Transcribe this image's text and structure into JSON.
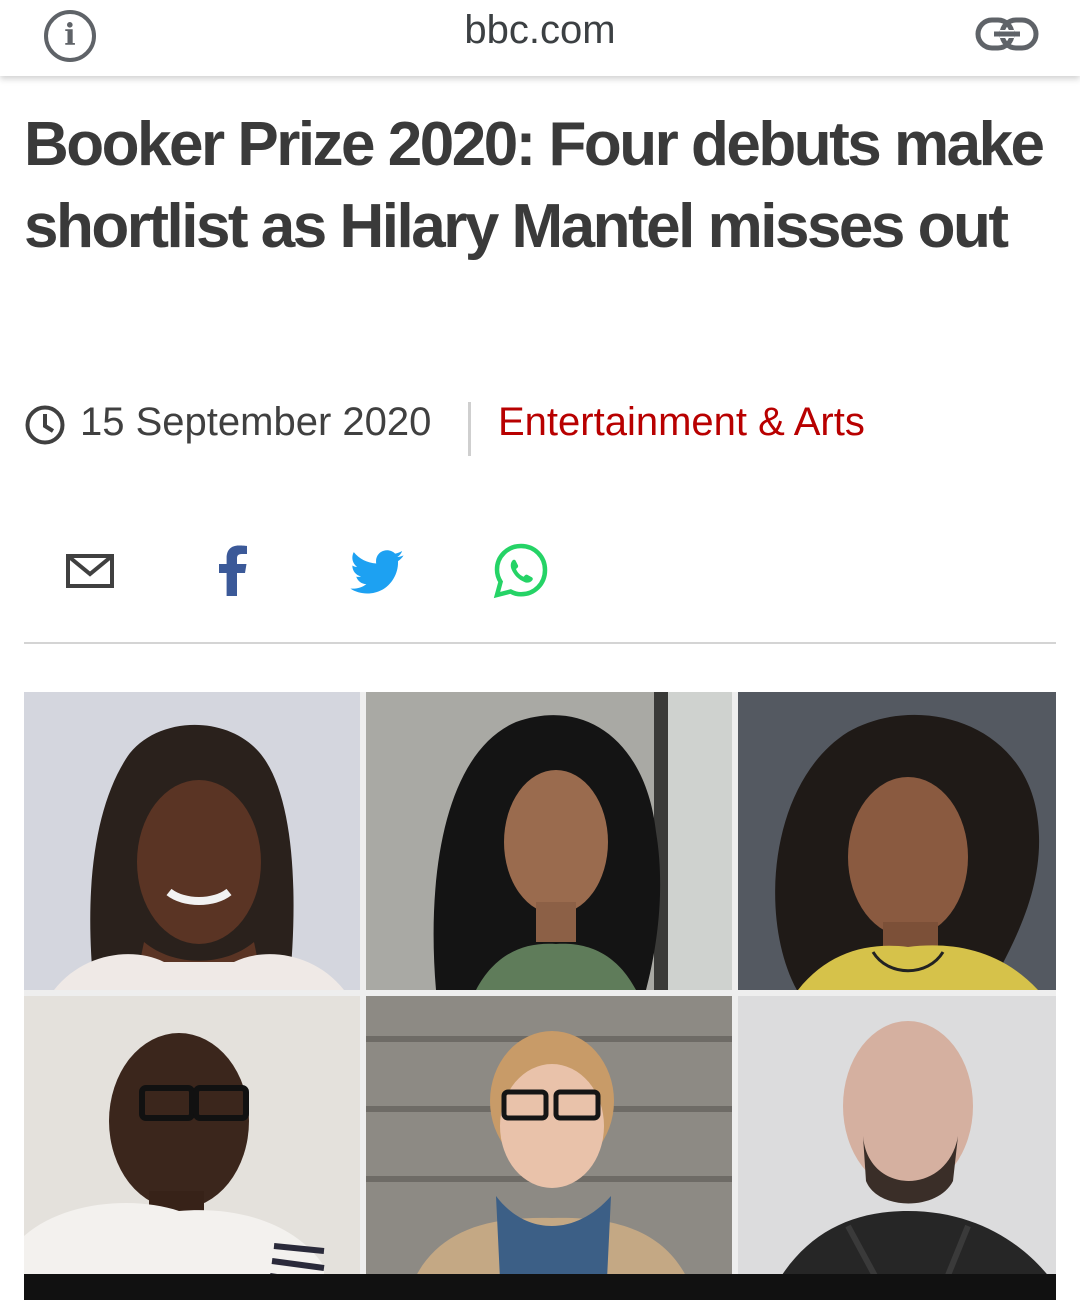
{
  "browser": {
    "domain": "bbc.com",
    "info_icon": "info-icon",
    "link_icon": "link-icon"
  },
  "article": {
    "headline": "Booker Prize 2020: Four debuts make shortlist as Hilary Mantel misses out",
    "date": "15 September 2020",
    "section": "Entertainment & Arts"
  },
  "share": [
    "email-icon",
    "facebook-icon",
    "twitter-icon",
    "whatsapp-icon"
  ],
  "colors": {
    "section_red": "#b80000",
    "facebook_blue": "#3b5998",
    "twitter_blue": "#1da1f2",
    "whatsapp_green": "#25d366"
  }
}
